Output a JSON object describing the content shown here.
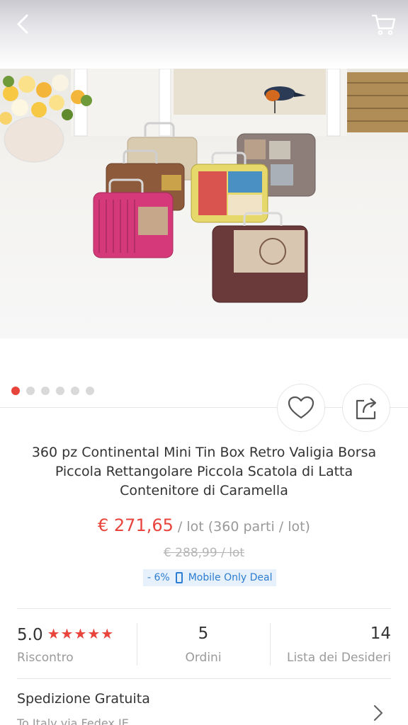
{
  "nav": {
    "back_icon": "chevron-left-icon",
    "cart_icon": "cart-icon"
  },
  "gallery": {
    "image_count": 6,
    "active_index": 0
  },
  "actions": {
    "wishlist_icon": "heart-icon",
    "share_icon": "share-icon"
  },
  "product": {
    "title": "360 pz Continental Mini Tin Box Retro Valigia Borsa Piccola Rettangolare Piccola Scatola di Latta Contenitore di Caramella",
    "price": "€ 271,65",
    "price_unit": " / lot (360 parti / lot)",
    "original_price": "€ 288,99  / lot",
    "discount": "- 6%",
    "deal_label": "Mobile Only Deal"
  },
  "stats": {
    "rating_value": "5.0",
    "rating_stars": "★★★★★",
    "rating_label": "Riscontro",
    "orders_value": "5",
    "orders_label": "Ordini",
    "wishlist_value": "14",
    "wishlist_label": "Lista dei Desideri"
  },
  "shipping": {
    "title": "Spedizione Gratuita",
    "subtitle": "To Italy via Fedex IE"
  },
  "colors": {
    "accent": "#e8443c",
    "deal_blue": "#2d7dd2"
  }
}
